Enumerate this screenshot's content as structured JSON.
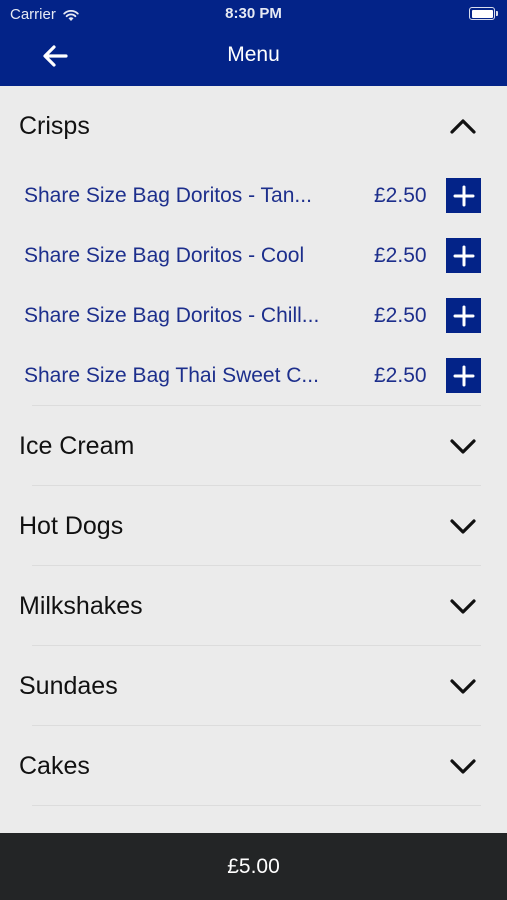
{
  "status_bar": {
    "carrier": "Carrier",
    "time": "8:30 PM"
  },
  "nav": {
    "title": "Menu",
    "back_icon": "arrow-left-icon"
  },
  "colors": {
    "brand": "#032388",
    "item_text": "#1d2f8c",
    "background": "#ebebeb",
    "footer": "#232526"
  },
  "menu": {
    "categories": [
      {
        "label": "Crisps",
        "expanded": true,
        "items": [
          {
            "name": "Share Size Bag Doritos - Tan...",
            "price": "£2.50"
          },
          {
            "name": "Share Size Bag Doritos - Cool",
            "price": "£2.50"
          },
          {
            "name": "Share Size Bag Doritos - Chill...",
            "price": "£2.50"
          },
          {
            "name": "Share Size Bag Thai Sweet C...",
            "price": "£2.50"
          }
        ]
      },
      {
        "label": "Ice Cream",
        "expanded": false
      },
      {
        "label": "Hot Dogs",
        "expanded": false
      },
      {
        "label": "Milkshakes",
        "expanded": false
      },
      {
        "label": "Sundaes",
        "expanded": false
      },
      {
        "label": "Cakes",
        "expanded": false
      }
    ]
  },
  "footer": {
    "total": "£5.00"
  }
}
